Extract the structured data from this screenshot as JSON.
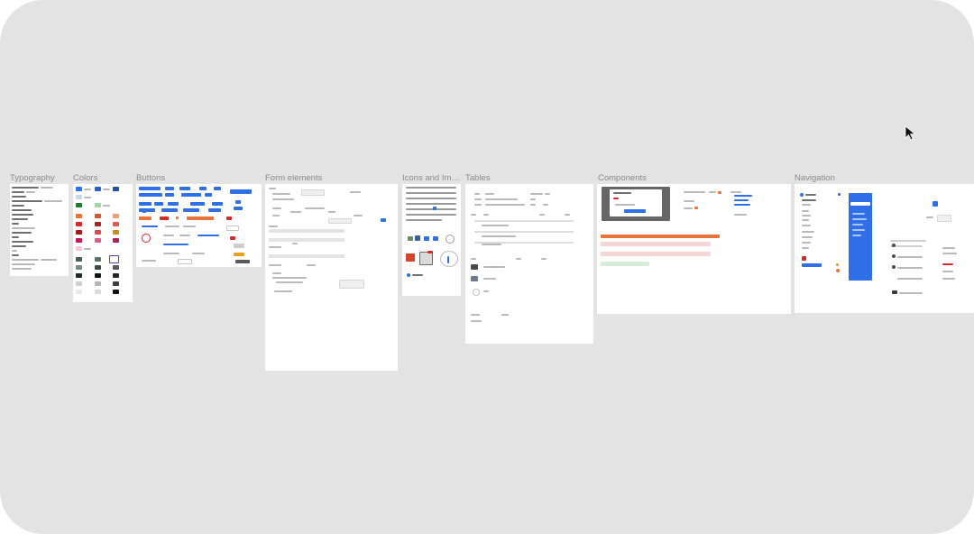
{
  "frames": [
    {
      "id": "typography",
      "label": "Typography"
    },
    {
      "id": "colors",
      "label": "Colors"
    },
    {
      "id": "buttons",
      "label": "Buttons"
    },
    {
      "id": "form-elements",
      "label": "Form elements"
    },
    {
      "id": "icons-and-images",
      "label": "Icons and Im…"
    },
    {
      "id": "tables",
      "label": "Tables"
    },
    {
      "id": "components",
      "label": "Components"
    },
    {
      "id": "navigation",
      "label": "Navigation"
    }
  ],
  "colors": {
    "canvas": "#e3e3e3",
    "frame": "#ffffff",
    "accent_blue": "#2f6fe8",
    "accent_orange": "#e8743b",
    "alert_red_bg": "#f7d6d6",
    "success_green_bg": "#d5ecd6",
    "label_gray": "#8a8a8a"
  },
  "cursor": {
    "icon": "arrow-cursor-icon"
  }
}
